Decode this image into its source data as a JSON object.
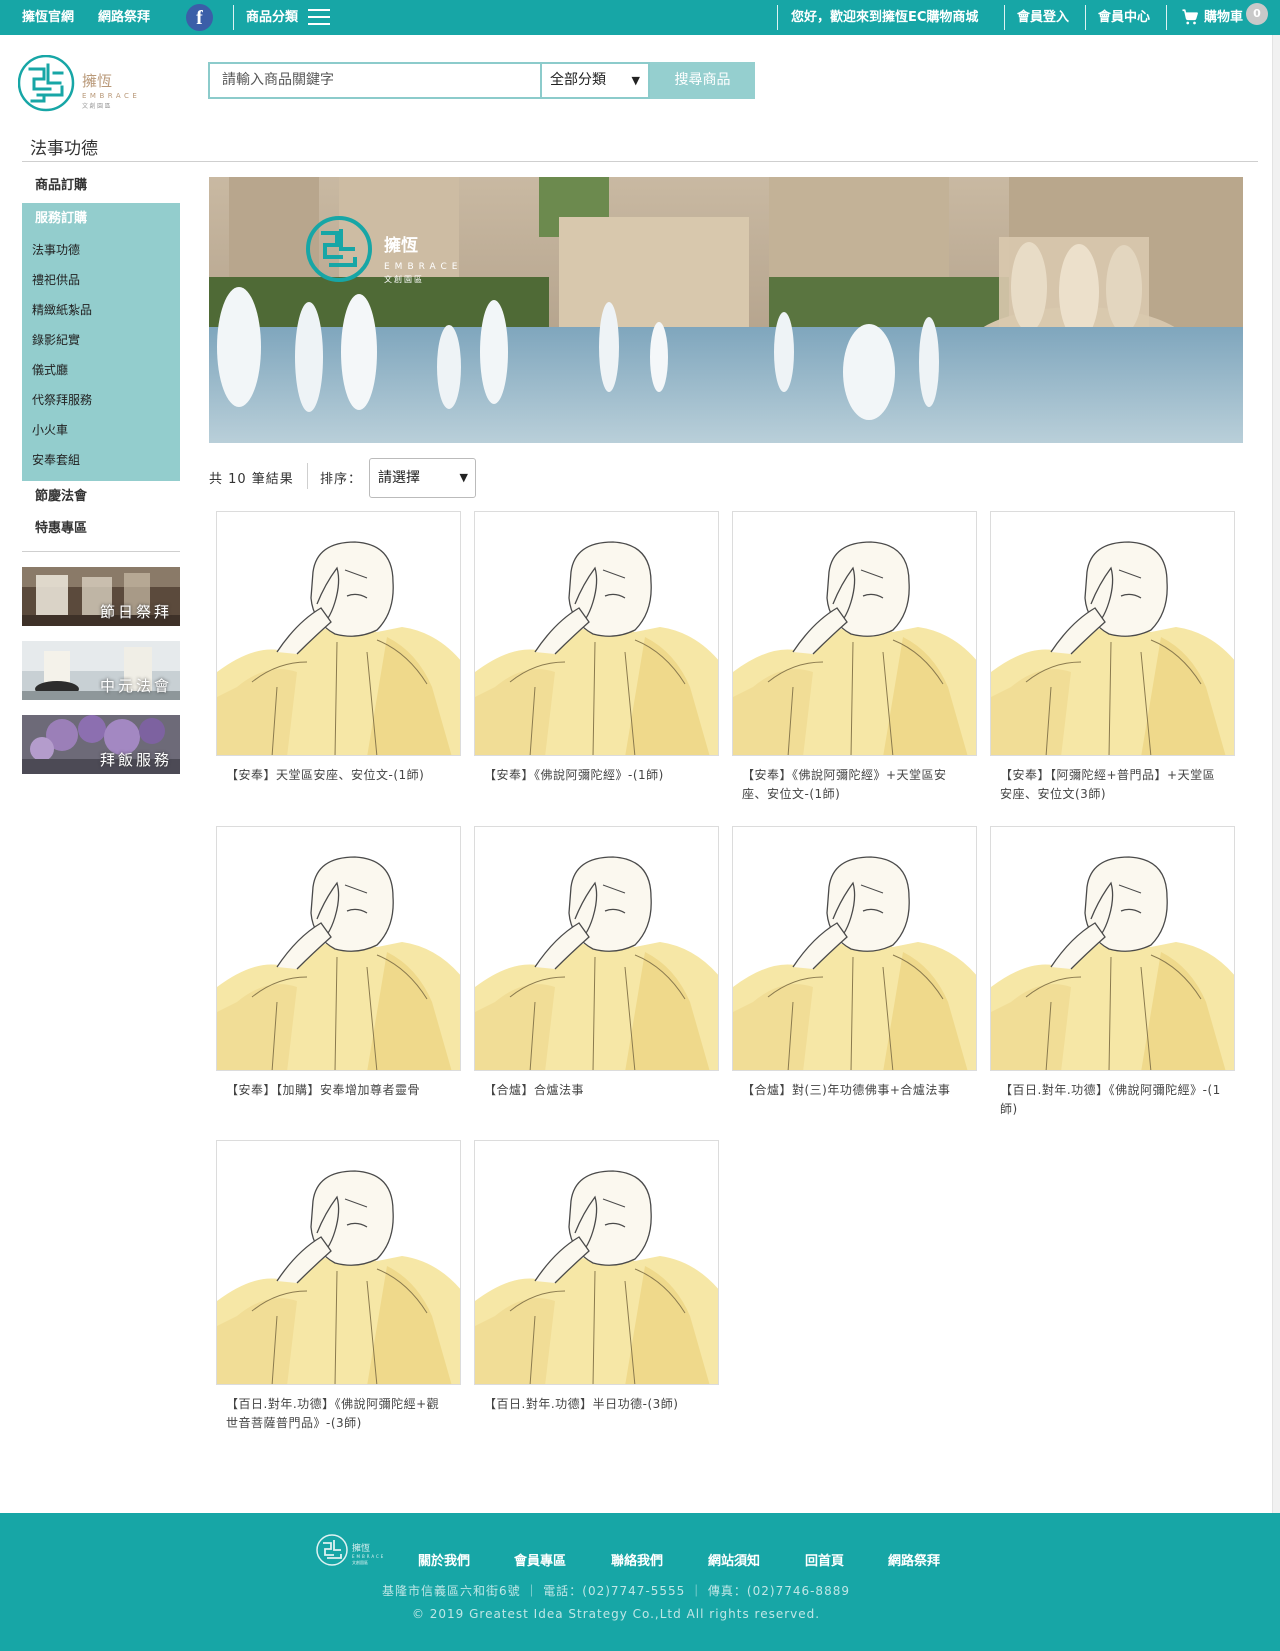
{
  "topbar": {
    "link_official": "擁恆官網",
    "link_worship": "網路祭拜",
    "fb_icon": "f",
    "category_menu": "商品分類",
    "welcome": "您好，歡迎來到擁恆EC購物商城",
    "login": "會員登入",
    "member_center": "會員中心",
    "cart": "購物車",
    "cart_count": "0"
  },
  "logo": {
    "name": "擁恆",
    "english": "EMBRACE",
    "subtitle": "文創園區"
  },
  "search": {
    "placeholder": "請輸入商品關鍵字",
    "category": "全部分類",
    "button": "搜尋商品"
  },
  "page": {
    "title": "法事功德"
  },
  "sidebar": {
    "product_order": "商品訂購",
    "service_order": "服務訂購",
    "sub_items": [
      {
        "label": "法事功德"
      },
      {
        "label": "禮祀供品"
      },
      {
        "label": "精緻紙紮品"
      },
      {
        "label": "錄影紀實"
      },
      {
        "label": "儀式廳"
      },
      {
        "label": "代祭拜服務"
      },
      {
        "label": "小火車"
      },
      {
        "label": "安奉套組"
      }
    ],
    "festival": "節慶法會",
    "special": "特惠專區",
    "promos": [
      {
        "label": "節日祭拜"
      },
      {
        "label": "中元法會"
      },
      {
        "label": "拜飯服務"
      }
    ]
  },
  "banner": {
    "brand": "擁恆",
    "english": "EMBRACE",
    "subtitle": "文創園區"
  },
  "results": {
    "count_text": "共 10 筆結果",
    "sort_label": "排序：",
    "sort_value": "請選擇"
  },
  "products": [
    {
      "name": "【安奉】天堂區安座、安位文-(1師)"
    },
    {
      "name": "【安奉】《佛說阿彌陀經》-(1師)"
    },
    {
      "name": "【安奉】《佛說阿彌陀經》+天堂區安座、安位文-(1師)"
    },
    {
      "name": "【安奉】【阿彌陀經+普門品】+天堂區安座、安位文(3師)"
    },
    {
      "name": "【安奉】【加購】安奉增加尊者靈骨"
    },
    {
      "name": "【合爐】合爐法事"
    },
    {
      "name": "【合爐】對(三)年功德佛事+合爐法事"
    },
    {
      "name": "【百日.對年.功德】《佛說阿彌陀經》-(1師)"
    },
    {
      "name": "【百日.對年.功德】《佛說阿彌陀經+觀世音菩薩普門品》-(3師)"
    },
    {
      "name": "【百日.對年.功德】半日功德-(3師)"
    }
  ],
  "footer": {
    "nav": [
      {
        "label": "關於我們"
      },
      {
        "label": "會員專區"
      },
      {
        "label": "聯絡我們"
      },
      {
        "label": "網站須知"
      },
      {
        "label": "回首頁"
      },
      {
        "label": "網路祭拜"
      }
    ],
    "address": "基隆市信義區六和街6號 ｜ 電話：(02)7747-5555 ｜ 傳真：(02)7746-8889",
    "copyright": "© 2019 Greatest Idea Strategy Co.,Ltd All rights reserved."
  },
  "colors": {
    "brand_teal": "#17a6a6",
    "sidebar_teal": "#93cdcd"
  }
}
